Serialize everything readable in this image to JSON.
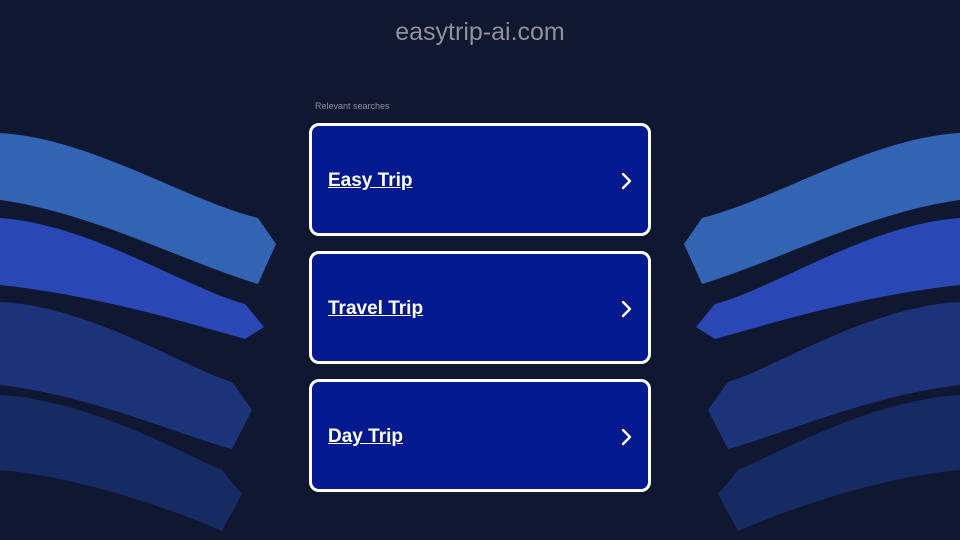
{
  "header": {
    "domain": "easytrip-ai.com"
  },
  "searches": {
    "label": "Relevant searches",
    "items": [
      {
        "label": "Easy Trip"
      },
      {
        "label": "Travel Trip"
      },
      {
        "label": "Day Trip"
      }
    ]
  },
  "icons": {
    "chevron": "chevron-right-icon"
  },
  "colors": {
    "background": "#101731",
    "card": "#021990",
    "card_border": "#ffffff",
    "wave_light": "#3264b4",
    "wave_mid": "#2a48b5",
    "wave_dark": "#1c3379",
    "wave_darkest": "#162a63"
  }
}
